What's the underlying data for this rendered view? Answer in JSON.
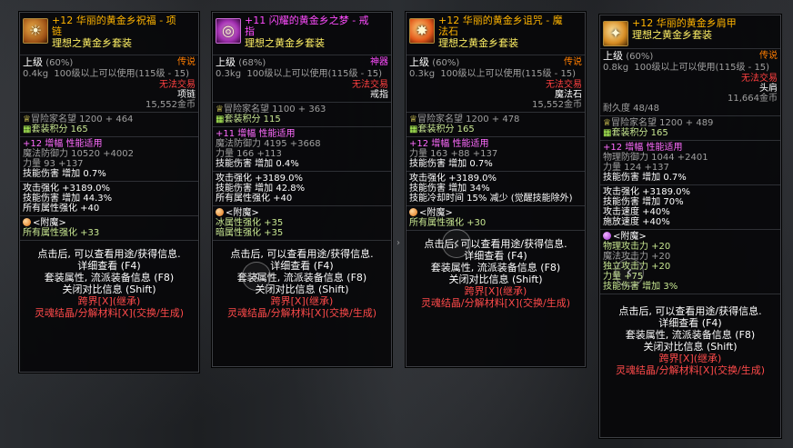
{
  "cards": [
    {
      "title": "+12 华丽的黄金乡祝福 - 项链",
      "title_l1": "+12 华丽的黄金乡祝福 - 项",
      "title_l2": "链",
      "set": "理想之黄金乡套装",
      "level_label": "上级",
      "level_pct": "(60%)",
      "rarity": "传说",
      "weight": "0.4kg",
      "use_req": "100级以上可以使用(115级 - 15)",
      "trade": "无法交易",
      "slot": "项链",
      "price": "15,552金币",
      "fame": "冒险家名望 1200 + 464",
      "setpts": "套装积分 165",
      "amp": "+12 增幅 性能适用",
      "stat1": "魔法防御力 10520 +4002",
      "stat2": "力量 93 +137",
      "stat3": "技能伤害 增加 0.7%",
      "bonus1": "攻击强化 +3189.0%",
      "bonus2": "技能伤害 增加 44.3%",
      "bonus3": "所有属性强化 +40",
      "enchant": "<附魔>",
      "enchant1": "所有属性强化 +33",
      "hint1": "点击后, 可以查看用途/获得信息.",
      "hint2": "详细查看 (F4)",
      "hint3": "套装属性, 流派装备信息 (F8)",
      "hint4": "关闭对比信息 (Shift)",
      "hint5": "跨界[X](继承)",
      "hint6": "灵魂结晶/分解材料[X](交换/生成)"
    },
    {
      "title_l1": "+11 闪耀的黄金乡之梦 - 戒",
      "title_l2": "指",
      "set": "理想之黄金乡套装",
      "level_label": "上级",
      "level_pct": "(68%)",
      "rarity": "神器",
      "weight": "0.3kg",
      "use_req": "100级以上可以使用(115级 - 15)",
      "trade": "无法交易",
      "slot": "戒指",
      "fame": "冒险家名望 1100 + 363",
      "setpts": "套装积分 115",
      "amp": "+11 增幅 性能适用",
      "stat1": "魔法防御力 4195 +3668",
      "stat2": "力量 166 +113",
      "stat3": "技能伤害 增加 0.4%",
      "bonus1": "攻击强化 +3189.0%",
      "bonus2": "技能伤害 增加 42.8%",
      "bonus3": "所有属性强化 +40",
      "enchant": "<附魔>",
      "enchant1": "冰属性强化 +35",
      "enchant2": "暗属性强化 +35",
      "hint1": "点击后, 可以查看用途/获得信息.",
      "hint2": "详细查看 (F4)",
      "hint3": "套装属性, 流派装备信息 (F8)",
      "hint4": "关闭对比信息 (Shift)",
      "hint5": "跨界[X](继承)",
      "hint6": "灵魂结晶/分解材料[X](交换/生成)"
    },
    {
      "title_l1": "+12 华丽的黄金乡诅咒 - 魔",
      "title_l2": "法石",
      "set": "理想之黄金乡套装",
      "level_label": "上级",
      "level_pct": "(60%)",
      "rarity": "传说",
      "weight": "0.3kg",
      "use_req": "100级以上可以使用(115级 - 15)",
      "trade": "无法交易",
      "slot": "魔法石",
      "price": "15,552金币",
      "fame": "冒险家名望 1200 + 478",
      "setpts": "套装积分 165",
      "amp": "+12 增幅 性能适用",
      "stat1": "力量 163 +88 +137",
      "stat2": "技能伤害 增加 0.7%",
      "bonus1": "攻击强化 +3189.0%",
      "bonus2": "技能伤害 增加 34%",
      "bonus3": "技能冷却时间 15% 减少 (觉醒技能除外)",
      "enchant": "<附魔>",
      "enchant1": "所有属性强化 +30",
      "hint1": "点击后, 可以查看用途/获得信息.",
      "hint2": "详细查看 (F4)",
      "hint3": "套装属性, 流派装备信息 (F8)",
      "hint4": "关闭对比信息 (Shift)",
      "hint5": "跨界[X](继承)",
      "hint6": "灵魂结晶/分解材料[X](交换/生成)"
    },
    {
      "title_l1": "+12 华丽的黄金乡肩甲",
      "set": "理想之黄金乡套装",
      "level_label": "上级",
      "level_pct": "(60%)",
      "rarity": "传说",
      "weight": "0.8kg",
      "use_req": "100级以上可以使用(115级 - 15)",
      "trade": "无法交易",
      "slot": "头肩",
      "price": "11,664金币",
      "durability": "耐久度 48/48",
      "fame": "冒险家名望 1200 + 489",
      "setpts": "套装积分 165",
      "amp": "+12 增幅 性能适用",
      "stat1": "物理防御力 1044 +2401",
      "stat2": "力量 124 +137",
      "stat3": "技能伤害 增加 0.7%",
      "bonus1": "攻击强化 +3189.0%",
      "bonus2": "技能伤害 增加 70%",
      "bonus3": "攻击速度 +40%",
      "bonus4": "施放速度 +40%",
      "enchant": "<附魔>",
      "enchant1": "物理攻击力 +20",
      "enchant2": "魔法攻击力 +20",
      "enchant3": "独立攻击力 +20",
      "enchant4": "力量 +75",
      "enchant5": "技能伤害 增加 3%",
      "hint1": "点击后, 可以查看用途/获得信息.",
      "hint2": "详细查看 (F4)",
      "hint3": "套装属性, 流派装备信息 (F8)",
      "hint4": "关闭对比信息 (Shift)",
      "hint5": "跨界[X](继承)",
      "hint6": "灵魂结晶/分解材料[X](交换/生成)"
    }
  ],
  "icons": {
    "neck": "☀",
    "ring": "◎",
    "stone": "✸",
    "shoulder": "✦",
    "fame": "♕",
    "set": "▦"
  },
  "nav": {
    "prev": "‹",
    "prev2": "‹",
    "prev3": "‹"
  },
  "colors": {
    "title": "#ffb400",
    "set": "#fff065",
    "legend": "#ff7d00",
    "artifact": "#ff4cff",
    "red": "#ff4040"
  }
}
